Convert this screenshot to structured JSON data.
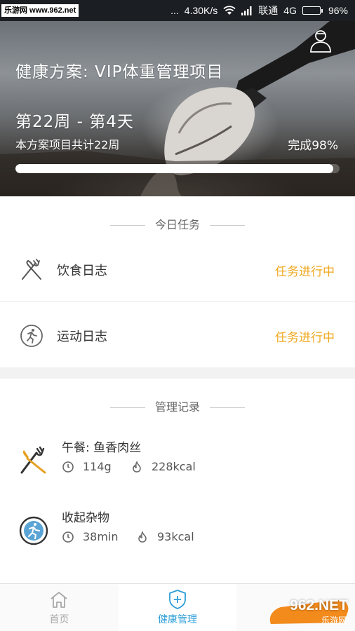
{
  "status_bar": {
    "watermark": "乐游网 www.962.net",
    "dots": "...",
    "speed": "4.30K/s",
    "carrier": "联通",
    "network": "4G",
    "battery": "96%",
    "battery_level": 0.96
  },
  "hero": {
    "title": "健康方案: VIP体重管理项目",
    "week_day": "第22周 - 第4天",
    "total": "本方案项目共计22周",
    "progress_text": "完成98%",
    "progress": 0.98,
    "user_icon": "user-avatar-icon"
  },
  "tasks": {
    "header": "今日任务",
    "items": [
      {
        "label": "饮食日志",
        "status": "任务进行中",
        "icon": "fork-knife-icon"
      },
      {
        "label": "运动日志",
        "status": "任务进行中",
        "icon": "running-icon"
      }
    ]
  },
  "records": {
    "header": "管理记录",
    "items": [
      {
        "title": "午餐: 鱼香肉丝",
        "metric1": "114g",
        "metric2": "228kcal",
        "icon": "fork-knife-icon"
      },
      {
        "title": "收起杂物",
        "metric1": "38min",
        "metric2": "93kcal",
        "icon": "running-icon"
      }
    ]
  },
  "nav": {
    "items": [
      {
        "label": "首页",
        "icon": "home-icon"
      },
      {
        "label": "健康管理",
        "icon": "shield-plus-icon"
      },
      {
        "label": "",
        "icon": ""
      }
    ]
  },
  "watermark_corner": {
    "brand": "962.NET",
    "sub": "乐游网"
  },
  "colors": {
    "accent": "#f0a820",
    "nav_active": "#2c9fd8",
    "nav_inactive": "#a8a8a8",
    "status_bar": "#1b1e22"
  }
}
